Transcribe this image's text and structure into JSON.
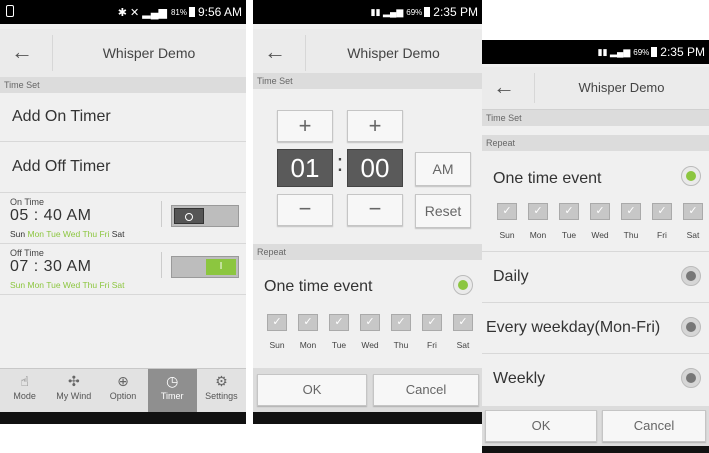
{
  "app_title": "Whisper Demo",
  "screen1": {
    "status_time": "9:56 AM",
    "status_battery": "81%",
    "section": "Time Set",
    "add_on": "Add On Timer",
    "add_off": "Add Off Timer",
    "on_timer": {
      "label": "On Time",
      "time": "05 : 40 AM",
      "days_plain_first": "Sun",
      "days_active": "Mon Tue Wed Thu Fri",
      "days_plain_last": "Sat",
      "switch": "off"
    },
    "off_timer": {
      "label": "Off Time",
      "time": "07 : 30 AM",
      "days_active": "Sun Mon Tue Wed Thu Fri Sat",
      "switch": "on"
    },
    "nav": [
      {
        "label": "Mode",
        "icon": "hand-icon"
      },
      {
        "label": "My Wind",
        "icon": "fan-icon"
      },
      {
        "label": "Option",
        "icon": "plus-circle-icon"
      },
      {
        "label": "Timer",
        "icon": "clock-icon",
        "active": true
      },
      {
        "label": "Settings",
        "icon": "gear-icon"
      }
    ]
  },
  "screen2": {
    "status_time": "2:35 PM",
    "status_battery": "69%",
    "section": "Time Set",
    "plus": "+",
    "minus": "−",
    "hour": "01",
    "colon": ":",
    "minute": "00",
    "ampm": "AM",
    "reset": "Reset",
    "repeat": "Repeat",
    "one_time": "One time event",
    "days": [
      "Sun",
      "Mon",
      "Tue",
      "Wed",
      "Thu",
      "Fri",
      "Sat"
    ],
    "ok": "OK",
    "cancel": "Cancel"
  },
  "screen3": {
    "status_time": "2:35 PM",
    "status_battery": "69%",
    "section": "Time Set",
    "repeat": "Repeat",
    "one_time": "One time event",
    "days": [
      "Sun",
      "Mon",
      "Tue",
      "Wed",
      "Thu",
      "Fri",
      "Sat"
    ],
    "daily": "Daily",
    "weekday": "Every weekday(Mon-Fri)",
    "weekly": "Weekly",
    "ok": "OK",
    "cancel": "Cancel"
  },
  "colors": {
    "accent": "#8cc63f",
    "appbar": "#ebebeb",
    "section": "#dcdcdc"
  }
}
